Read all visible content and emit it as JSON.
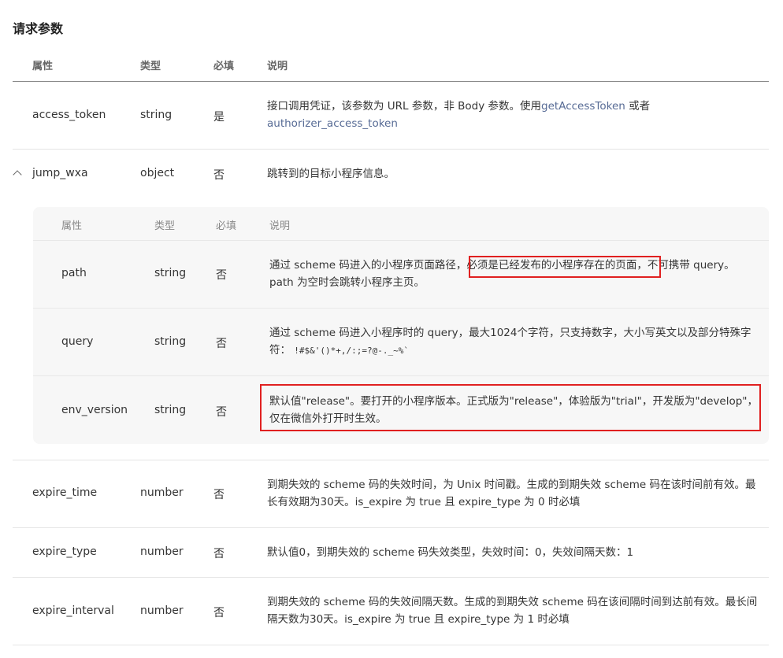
{
  "section_title": "请求参数",
  "headers": {
    "attr": "属性",
    "type": "类型",
    "required": "必填",
    "desc": "说明"
  },
  "rows": {
    "access_token": {
      "name": "access_token",
      "type": "string",
      "required": "是",
      "desc_pre": "接口调用凭证，该参数为 URL 参数，非 Body 参数。使用",
      "link1": "getAccessToken",
      "desc_mid": " 或者",
      "link2": "authorizer_access_token"
    },
    "jump_wxa": {
      "name": "jump_wxa",
      "type": "object",
      "required": "否",
      "desc": "跳转到的目标小程序信息。"
    },
    "expire_time": {
      "name": "expire_time",
      "type": "number",
      "required": "否",
      "desc_l1": "到期失效的 scheme 码的失效时间，为 Unix 时间戳。生成的到期失效 scheme 码在该时间前有效。最",
      "desc_l2": "长有效期为30天。is_expire 为 true 且 expire_type 为 0 时必填"
    },
    "expire_type": {
      "name": "expire_type",
      "type": "number",
      "required": "否",
      "desc": "默认值0，到期失效的 scheme 码失效类型，失效时间：0，失效间隔天数：1"
    },
    "expire_interval": {
      "name": "expire_interval",
      "type": "number",
      "required": "否",
      "desc_l1": "到期失效的 scheme 码的失效间隔天数。生成的到期失效 scheme 码在该间隔时间到达前有效。最长间",
      "desc_l2": "隔天数为30天。is_expire 为 true 且 expire_type 为 1 时必填"
    }
  },
  "nested": {
    "headers": {
      "attr": "属性",
      "type": "类型",
      "required": "必填",
      "desc": "说明"
    },
    "path": {
      "name": "path",
      "type": "string",
      "required": "否",
      "desc_a": "通过 scheme 码进入的小程序页面路径，",
      "desc_b": "必须是已经发布的小程序存在的页面，",
      "desc_c": "不可携带 query。",
      "desc_l2": "path 为空时会跳转小程序主页。"
    },
    "query": {
      "name": "query",
      "type": "string",
      "required": "否",
      "desc_l1": "通过 scheme 码进入小程序时的 query，最大1024个字符，只支持数字，大小写英文以及部分特殊字",
      "desc_l2": "符：",
      "special": "!#$&'()*+,/:;=?@-._~%`"
    },
    "env_version": {
      "name": "env_version",
      "type": "string",
      "required": "否",
      "desc_l1": "默认值\"release\"。要打开的小程序版本。正式版为\"release\"，体验版为\"trial\"，开发版为\"develop\"，",
      "desc_l2": "仅在微信外打开时生效。"
    }
  },
  "colors": {
    "link": "#576b95",
    "highlight_box": "#e02020",
    "nested_bg": "#f7f7f7"
  }
}
